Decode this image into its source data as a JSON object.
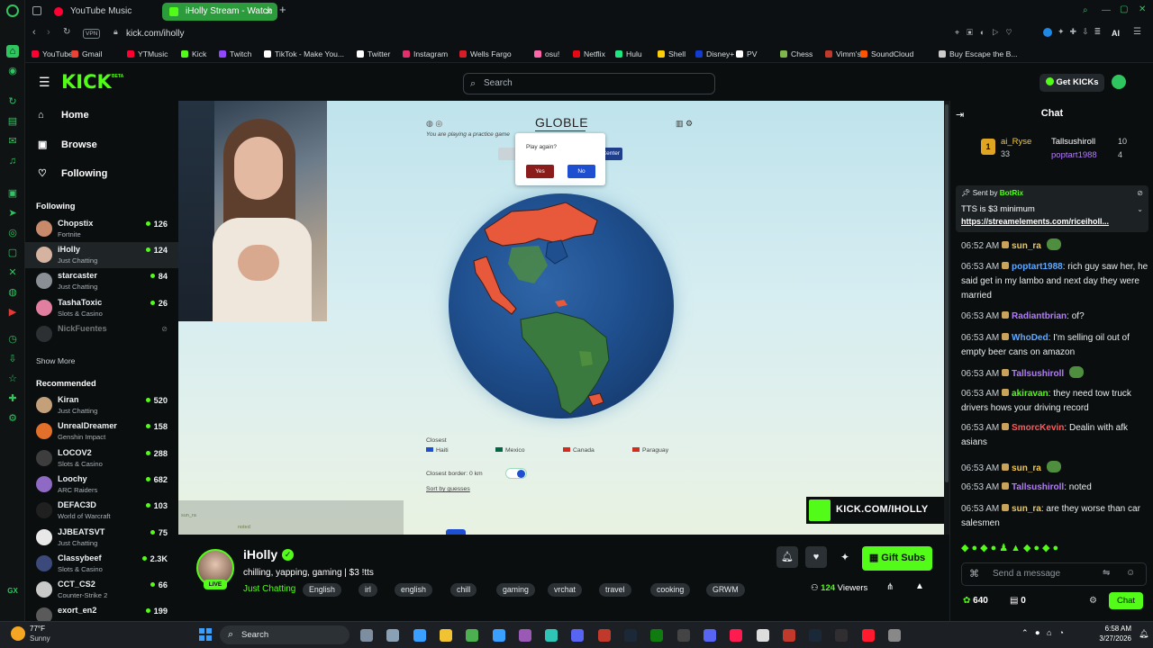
{
  "browser": {
    "tabs": [
      {
        "title": "YouTube Music",
        "favicon_color": "#ff0033"
      },
      {
        "title": "iHolly Stream - Watch",
        "favicon_color": "#53fc18"
      }
    ],
    "new_tab": "+",
    "vpn_label": "VPN",
    "url": "kick.com/iholly",
    "ai_label": "AI",
    "bookmarks": [
      {
        "label": "YouTube",
        "color": "#ff0033"
      },
      {
        "label": "Gmail",
        "color": "#ea4335"
      },
      {
        "label": "YTMusic",
        "color": "#ff0033"
      },
      {
        "label": "Kick",
        "color": "#53fc18"
      },
      {
        "label": "Twitch",
        "color": "#9146ff"
      },
      {
        "label": "TikTok - Make You...",
        "color": "#ffffff"
      },
      {
        "label": "Twitter",
        "color": "#ffffff"
      },
      {
        "label": "Instagram",
        "color": "#e1306c"
      },
      {
        "label": "Wells Fargo",
        "color": "#d71e28"
      },
      {
        "label": "osu!",
        "color": "#ff66aa"
      },
      {
        "label": "Netflix",
        "color": "#e50914"
      },
      {
        "label": "Hulu",
        "color": "#1ce783"
      },
      {
        "label": "Shell",
        "color": "#fbce07"
      },
      {
        "label": "Disney+",
        "color": "#113ccf"
      },
      {
        "label": "PV",
        "color": "#ffffff"
      },
      {
        "label": "Chess",
        "color": "#81b64c"
      },
      {
        "label": "Vimm's",
        "color": "#c0392b"
      },
      {
        "label": "SoundCloud",
        "color": "#ff5500"
      },
      {
        "label": "Buy Escape the B...",
        "color": "#cccccc"
      }
    ]
  },
  "kick": {
    "logo": "KICK",
    "beta": "BETA",
    "search_placeholder": "Search",
    "get_kicks": "Get KICKs",
    "accent": "#53fc18"
  },
  "sidebar": {
    "nav": [
      {
        "label": "Home",
        "icon": "home-icon"
      },
      {
        "label": "Browse",
        "icon": "browse-icon"
      },
      {
        "label": "Following",
        "icon": "heart-icon"
      }
    ],
    "following_title": "Following",
    "following": [
      {
        "name": "Chopstix",
        "category": "Fortnite",
        "viewers": "126",
        "color": "#c98a6b"
      },
      {
        "name": "iHolly",
        "category": "Just Chatting",
        "viewers": "124",
        "color": "#d6b3a0"
      },
      {
        "name": "starcaster",
        "category": "Just Chatting",
        "viewers": "84",
        "color": "#8a8f96"
      },
      {
        "name": "TashaToxic",
        "category": "Slots & Casino",
        "viewers": "26",
        "color": "#e27fa0"
      },
      {
        "name": "NickFuentes",
        "category": "",
        "viewers": "",
        "color": "#555a5e"
      }
    ],
    "show_more": "Show More",
    "recommended_title": "Recommended",
    "recommended": [
      {
        "name": "Kiran",
        "category": "Just Chatting",
        "viewers": "520",
        "color": "#c4a07a"
      },
      {
        "name": "UnrealDreamer",
        "category": "Genshin Impact",
        "viewers": "158",
        "color": "#e2702a"
      },
      {
        "name": "LOCOV2",
        "category": "Slots & Casino",
        "viewers": "288",
        "color": "#3d3d3d"
      },
      {
        "name": "Loochy",
        "category": "ARC Raiders",
        "viewers": "682",
        "color": "#8e6ac4"
      },
      {
        "name": "DEFAC3D",
        "category": "World of Warcraft",
        "viewers": "103",
        "color": "#202020"
      },
      {
        "name": "JJBEATSVT",
        "category": "Just Chatting",
        "viewers": "75",
        "color": "#e8e8e8"
      },
      {
        "name": "Classybeef",
        "category": "Slots & Casino",
        "viewers": "2.3K",
        "color": "#3b4a7a"
      },
      {
        "name": "CCT_CS2",
        "category": "Counter-Strike 2",
        "viewers": "66",
        "color": "#c9c9c9"
      },
      {
        "name": "exort_en2",
        "category": "",
        "viewers": "199",
        "color": "#5a5a5a"
      }
    ]
  },
  "stream": {
    "game_title": "GLOBLE",
    "game_subtitle": "You are playing a practice game",
    "popup_text": "Play again?",
    "popup_yes": "Yes",
    "popup_no": "No",
    "behind_button": "Center",
    "closest_label": "Closest",
    "closest_countries": [
      "Haiti",
      "Mexico",
      "Canada",
      "Paraguay"
    ],
    "closest_border": "Closest border: 0  km",
    "sort_by": "Sort by guesses",
    "overlay_chat_1": "sun_ra",
    "overlay_chat_2": "noted",
    "watermark": "KICK.COM/IHOLLY"
  },
  "channel": {
    "name": "iHolly",
    "live_badge": "LIVE",
    "title": "chilling, yapping, gaming | $3 !tts",
    "category": "Just Chatting",
    "tags": [
      "English",
      "irl",
      "english",
      "chill",
      "gaming",
      "vrchat",
      "travel",
      "cooking",
      "GRWM"
    ],
    "gift_subs": "Gift Subs",
    "viewers": "124",
    "viewers_label": "Viewers"
  },
  "chat": {
    "title": "Chat",
    "top_gifters": [
      {
        "name": "ai_Ryse",
        "count": "33"
      },
      {
        "name": "Tallsushiroll",
        "count": "10"
      },
      {
        "name": "poptart1988",
        "count": "4"
      }
    ],
    "pinned_by": "Sent by",
    "pinned_user": "BotRix",
    "pinned_text": "TTS is $3 minimum",
    "pinned_link": "https://streamelements.com/riceiholl...",
    "messages": [
      {
        "time": "06:52 AM",
        "user": "sun_ra",
        "color": "#f2c94c",
        "text": ""
      },
      {
        "time": "06:53 AM",
        "user": "poptart1988",
        "color": "#5fa8ff",
        "text": "rich guy saw her, he said get in my lambo and next day they were married"
      },
      {
        "time": "06:53 AM",
        "user": "Radiantbrian",
        "color": "#b57bff",
        "text": "of?"
      },
      {
        "time": "06:53 AM",
        "user": "WhoDed",
        "color": "#5fa8ff",
        "text": "I'm selling oil out of empty beer cans on amazon"
      },
      {
        "time": "06:53 AM",
        "user": "Tallsushiroll",
        "color": "#b57bff",
        "text": ""
      },
      {
        "time": "06:53 AM",
        "user": "akiravan",
        "color": "#53fc18",
        "text": "they need tow truck drivers hows your driving record"
      },
      {
        "time": "06:53 AM",
        "user": "SmorcKevin",
        "color": "#ff5a5a",
        "text": "Dealin with afk asians"
      },
      {
        "time": "06:53 AM",
        "user": "sun_ra",
        "color": "#f2c94c",
        "text": ""
      },
      {
        "time": "06:53 AM",
        "user": "Tallsushiroll",
        "color": "#b57bff",
        "text": "noted"
      },
      {
        "time": "06:53 AM",
        "user": "sun_ra",
        "color": "#f2c94c",
        "text": "are they worse than car salesmen"
      }
    ],
    "input_placeholder": "Send a message",
    "points": "640",
    "items": "0",
    "send_label": "Chat"
  },
  "taskbar": {
    "weather_temp": "77°F",
    "weather_desc": "Sunny",
    "search": "Search",
    "time": "6:58 AM",
    "date": "3/27/2026"
  }
}
